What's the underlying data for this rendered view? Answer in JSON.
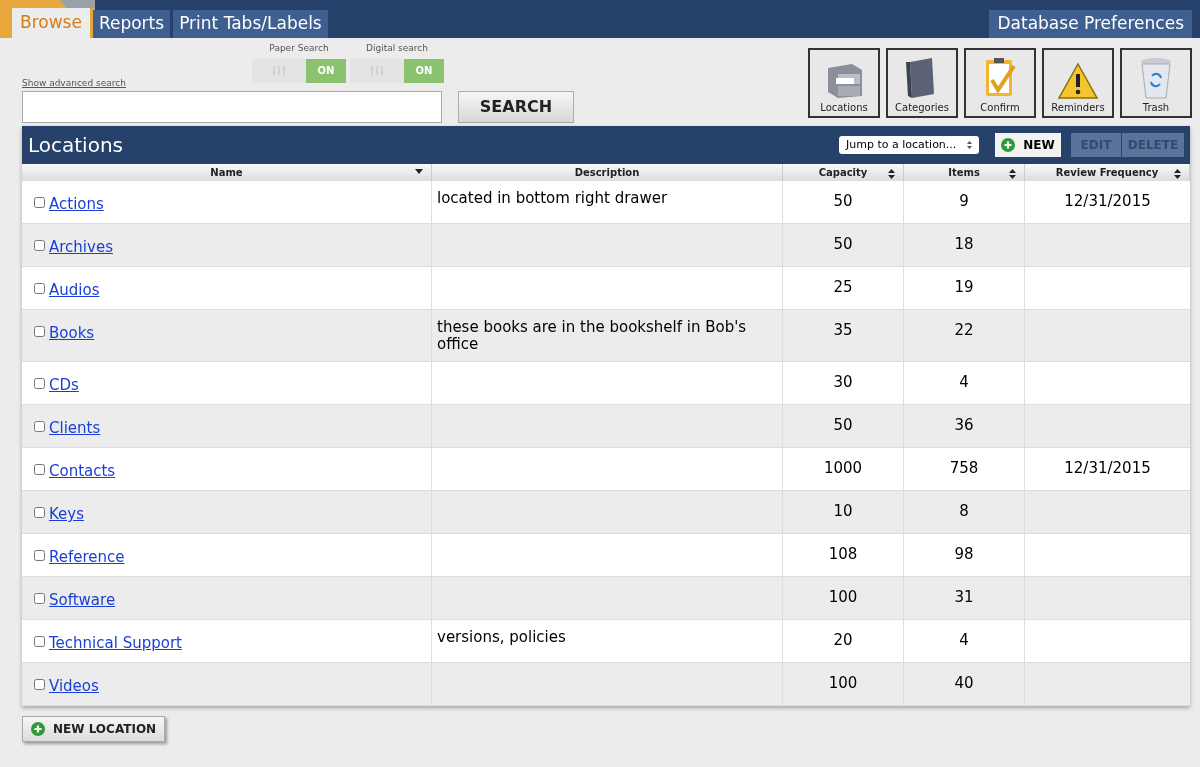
{
  "tabs": [
    {
      "label": "Browse",
      "selected": true
    },
    {
      "label": "Reports",
      "selected": false
    },
    {
      "label": "Print Tabs/Labels",
      "selected": false
    }
  ],
  "preferences_button": "Database Preferences",
  "advanced_search_link": "Show advanced search",
  "toggles": [
    {
      "label": "Paper Search",
      "state_text": "ON",
      "on": true
    },
    {
      "label": "Digital search",
      "state_text": "ON",
      "on": true
    }
  ],
  "search_button": "SEARCH",
  "toolbar": [
    {
      "label": "Locations",
      "kind": "cabinet"
    },
    {
      "label": "Categories",
      "kind": "book"
    },
    {
      "label": "Confirm",
      "kind": "clipboard"
    },
    {
      "label": "Reminders",
      "kind": "warning"
    },
    {
      "label": "Trash",
      "kind": "trash"
    }
  ],
  "panel": {
    "title": "Locations",
    "jump_select": "Jump to a location...",
    "new_button": "NEW",
    "edit_button": "EDIT",
    "delete_button": "DELETE",
    "edit_disabled": true,
    "delete_disabled": true
  },
  "table": {
    "columns": [
      {
        "label": "Name",
        "kind": "sorted"
      },
      {
        "label": "Description",
        "kind": "plain"
      },
      {
        "label": "Capacity",
        "kind": "sortable"
      },
      {
        "label": "Items",
        "kind": "sortable"
      },
      {
        "label": "Review Frequency",
        "kind": "sortable"
      }
    ],
    "rows": [
      {
        "name": "Actions",
        "description": "located in bottom right drawer",
        "capacity": "50",
        "items": "9",
        "review": "12/31/2015",
        "checked": false
      },
      {
        "name": "Archives",
        "description": "",
        "capacity": "50",
        "items": "18",
        "review": "",
        "checked": false
      },
      {
        "name": "Audios",
        "description": "",
        "capacity": "25",
        "items": "19",
        "review": "",
        "checked": false
      },
      {
        "name": "Books",
        "description": "these books are in the bookshelf in Bob's office",
        "capacity": "35",
        "items": "22",
        "review": "",
        "checked": false
      },
      {
        "name": "CDs",
        "description": "",
        "capacity": "30",
        "items": "4",
        "review": "",
        "checked": false
      },
      {
        "name": "Clients",
        "description": "",
        "capacity": "50",
        "items": "36",
        "review": "",
        "checked": false
      },
      {
        "name": "Contacts",
        "description": "",
        "capacity": "1000",
        "items": "758",
        "review": "12/31/2015",
        "checked": false
      },
      {
        "name": "Keys",
        "description": "",
        "capacity": "10",
        "items": "8",
        "review": "",
        "checked": false
      },
      {
        "name": "Reference",
        "description": "",
        "capacity": "108",
        "items": "98",
        "review": "",
        "checked": false
      },
      {
        "name": "Software",
        "description": "",
        "capacity": "100",
        "items": "31",
        "review": "",
        "checked": false
      },
      {
        "name": "Technical Support",
        "description": "versions, policies",
        "capacity": "20",
        "items": "4",
        "review": "",
        "checked": false
      },
      {
        "name": "Videos",
        "description": "",
        "capacity": "100",
        "items": "40",
        "review": "",
        "checked": false
      }
    ]
  },
  "new_location_button": "NEW LOCATION"
}
